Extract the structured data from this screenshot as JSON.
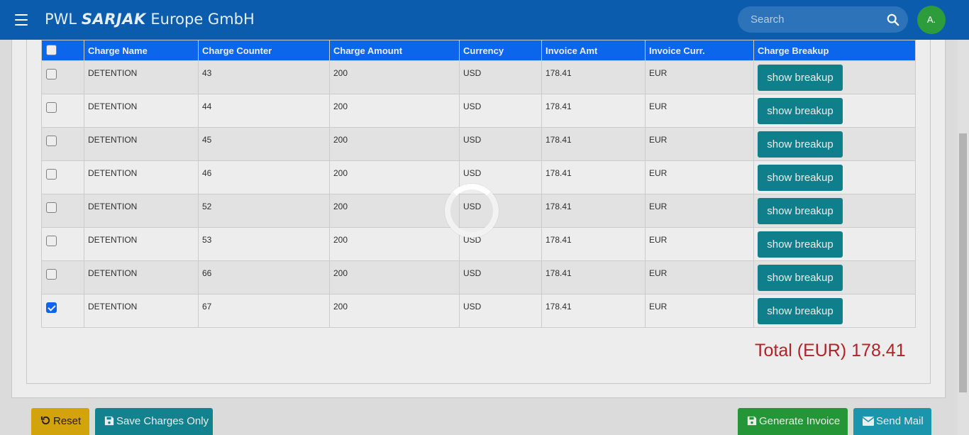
{
  "header": {
    "brand_prefix": "PWL",
    "brand_logo": "SARJAK",
    "brand_suffix": "Europe GmbH",
    "search_placeholder": "Search",
    "avatar_initials": "A.",
    "colors": {
      "topbar": "#0b5cad",
      "avatar": "#2c9d3a"
    }
  },
  "table": {
    "columns": [
      "Charge Name",
      "Charge Counter",
      "Charge Amount",
      "Currency",
      "Invoice Amt",
      "Invoice Curr.",
      "Charge Breakup"
    ],
    "rows": [
      {
        "checked": false,
        "charge_name": "DETENTION",
        "charge_counter": "43",
        "charge_amount": "200",
        "currency": "USD",
        "invoice_amt": "178.41",
        "invoice_curr": "EUR",
        "button": "show breakup"
      },
      {
        "checked": false,
        "charge_name": "DETENTION",
        "charge_counter": "44",
        "charge_amount": "200",
        "currency": "USD",
        "invoice_amt": "178.41",
        "invoice_curr": "EUR",
        "button": "show breakup"
      },
      {
        "checked": false,
        "charge_name": "DETENTION",
        "charge_counter": "45",
        "charge_amount": "200",
        "currency": "USD",
        "invoice_amt": "178.41",
        "invoice_curr": "EUR",
        "button": "show breakup"
      },
      {
        "checked": false,
        "charge_name": "DETENTION",
        "charge_counter": "46",
        "charge_amount": "200",
        "currency": "USD",
        "invoice_amt": "178.41",
        "invoice_curr": "EUR",
        "button": "show breakup"
      },
      {
        "checked": false,
        "charge_name": "DETENTION",
        "charge_counter": "52",
        "charge_amount": "200",
        "currency": "USD",
        "invoice_amt": "178.41",
        "invoice_curr": "EUR",
        "button": "show breakup"
      },
      {
        "checked": false,
        "charge_name": "DETENTION",
        "charge_counter": "53",
        "charge_amount": "200",
        "currency": "USD",
        "invoice_amt": "178.41",
        "invoice_curr": "EUR",
        "button": "show breakup"
      },
      {
        "checked": false,
        "charge_name": "DETENTION",
        "charge_counter": "66",
        "charge_amount": "200",
        "currency": "USD",
        "invoice_amt": "178.41",
        "invoice_curr": "EUR",
        "button": "show breakup"
      },
      {
        "checked": true,
        "charge_name": "DETENTION",
        "charge_counter": "67",
        "charge_amount": "200",
        "currency": "USD",
        "invoice_amt": "178.41",
        "invoice_curr": "EUR",
        "button": "show breakup"
      }
    ],
    "header_color": "#0d6efd",
    "button_color": "#118a96"
  },
  "total": {
    "text": "Total (EUR) 178.41",
    "color": "#c0262a"
  },
  "footer": {
    "reset_label": "Reset",
    "save_label": "Save Charges Only",
    "generate_label": "Generate Invoice",
    "mail_label": "Send Mail",
    "icons": {
      "reset": "undo-icon",
      "save": "floppy-icon",
      "generate": "floppy-icon",
      "mail": "envelope-icon"
    }
  },
  "loading": {
    "visible": true
  }
}
